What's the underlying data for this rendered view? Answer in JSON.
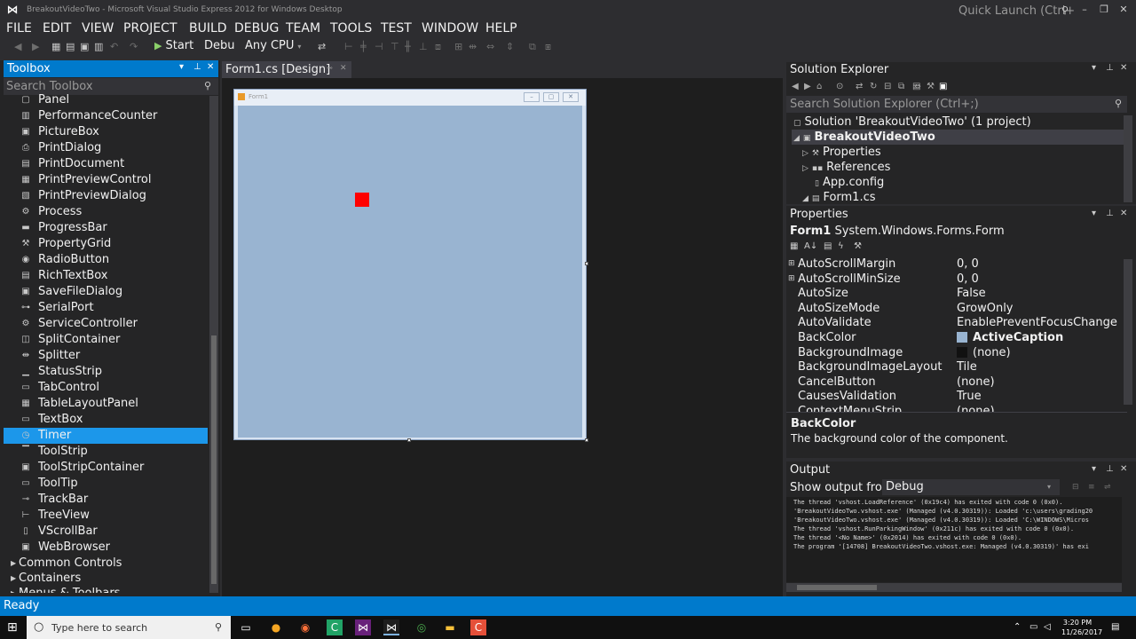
{
  "window": {
    "title": "BreakoutVideoTwo - Microsoft Visual Studio Express 2012 for Windows Desktop",
    "quick_launch_placeholder": "Quick Launch (Ctrl+Q)"
  },
  "menu": [
    "FILE",
    "EDIT",
    "VIEW",
    "PROJECT",
    "BUILD",
    "DEBUG",
    "TEAM",
    "TOOLS",
    "TEST",
    "WINDOW",
    "HELP"
  ],
  "toolbar": {
    "start_label": "Start",
    "config_value": "Debu",
    "platform_value": "Any CPU"
  },
  "toolbox": {
    "title": "Toolbox",
    "search_placeholder": "Search Toolbox",
    "items": [
      {
        "label": "Panel",
        "icon": "panel-icon"
      },
      {
        "label": "PerformanceCounter",
        "icon": "counter-icon"
      },
      {
        "label": "PictureBox",
        "icon": "picture-icon"
      },
      {
        "label": "PrintDialog",
        "icon": "print-icon"
      },
      {
        "label": "PrintDocument",
        "icon": "document-icon"
      },
      {
        "label": "PrintPreviewControl",
        "icon": "preview-icon"
      },
      {
        "label": "PrintPreviewDialog",
        "icon": "preview-dialog-icon"
      },
      {
        "label": "Process",
        "icon": "process-icon"
      },
      {
        "label": "ProgressBar",
        "icon": "progress-icon"
      },
      {
        "label": "PropertyGrid",
        "icon": "wrench-icon"
      },
      {
        "label": "RadioButton",
        "icon": "radio-icon"
      },
      {
        "label": "RichTextBox",
        "icon": "richtext-icon"
      },
      {
        "label": "SaveFileDialog",
        "icon": "save-icon"
      },
      {
        "label": "SerialPort",
        "icon": "port-icon"
      },
      {
        "label": "ServiceController",
        "icon": "service-icon"
      },
      {
        "label": "SplitContainer",
        "icon": "split-icon"
      },
      {
        "label": "Splitter",
        "icon": "splitter-icon"
      },
      {
        "label": "StatusStrip",
        "icon": "statusstrip-icon"
      },
      {
        "label": "TabControl",
        "icon": "tab-icon"
      },
      {
        "label": "TableLayoutPanel",
        "icon": "table-icon"
      },
      {
        "label": "TextBox",
        "icon": "textbox-icon"
      },
      {
        "label": "Timer",
        "icon": "timer-icon"
      },
      {
        "label": "ToolStrip",
        "icon": "toolstrip-icon"
      },
      {
        "label": "ToolStripContainer",
        "icon": "toolstrip-container-icon"
      },
      {
        "label": "ToolTip",
        "icon": "tooltip-icon"
      },
      {
        "label": "TrackBar",
        "icon": "trackbar-icon"
      },
      {
        "label": "TreeView",
        "icon": "treeview-icon"
      },
      {
        "label": "VScrollBar",
        "icon": "vscroll-icon"
      },
      {
        "label": "WebBrowser",
        "icon": "web-icon"
      }
    ],
    "selected_index": 21,
    "categories": [
      "Common Controls",
      "Containers",
      "Menus & Toolbars"
    ]
  },
  "document": {
    "tab_label": "Form1.cs [Design]",
    "form_title": "Form1"
  },
  "solution_explorer": {
    "title": "Solution Explorer",
    "search_placeholder": "Search Solution Explorer (Ctrl+;)",
    "tree": [
      {
        "label": "Solution 'BreakoutVideoTwo' (1 project)",
        "icon": "solution-icon"
      },
      {
        "label": "BreakoutVideoTwo",
        "icon": "csharp-project-icon"
      },
      {
        "label": "Properties",
        "icon": "wrench-icon"
      },
      {
        "label": "References",
        "icon": "references-icon"
      },
      {
        "label": "App.config",
        "icon": "config-icon"
      },
      {
        "label": "Form1.cs",
        "icon": "form-icon"
      }
    ]
  },
  "properties": {
    "title": "Properties",
    "object_name": "Form1",
    "object_type": "System.Windows.Forms.Form",
    "rows": [
      {
        "name": "AutoScrollMargin",
        "value": "0, 0",
        "expandable": true
      },
      {
        "name": "AutoScrollMinSize",
        "value": "0, 0",
        "expandable": true
      },
      {
        "name": "AutoSize",
        "value": "False"
      },
      {
        "name": "AutoSizeMode",
        "value": "GrowOnly"
      },
      {
        "name": "AutoValidate",
        "value": "EnablePreventFocusChange"
      },
      {
        "name": "BackColor",
        "value": "ActiveCaption",
        "swatch": "#99b4d1"
      },
      {
        "name": "BackgroundImage",
        "value": "(none)",
        "swatch": "#111111"
      },
      {
        "name": "BackgroundImageLayout",
        "value": "Tile"
      },
      {
        "name": "CancelButton",
        "value": "(none)"
      },
      {
        "name": "CausesValidation",
        "value": "True"
      },
      {
        "name": "ContextMenuStrip",
        "value": "(none)"
      }
    ],
    "description_title": "BackColor",
    "description_text": "The background color of the component."
  },
  "output": {
    "title": "Output",
    "show_from_label": "Show output from:",
    "source_value": "Debug",
    "lines": [
      "The thread 'vshost.LoadReference' (0x19c4) has exited with code 0 (0x0).",
      "'BreakoutVideoTwo.vshost.exe' (Managed (v4.0.30319)): Loaded 'c:\\users\\grading20",
      "'BreakoutVideoTwo.vshost.exe' (Managed (v4.0.30319)): Loaded 'C:\\WINDOWS\\Micros",
      "The thread 'vshost.RunParkingWindow' (0x211c) has exited with code 0 (0x0).",
      "The thread '<No Name>' (0x2014) has exited with code 0 (0x0).",
      "The program '[14708] BreakoutVideoTwo.vshost.exe: Managed (v4.0.30319)' has exi"
    ]
  },
  "status": {
    "text": "Ready"
  },
  "taskbar": {
    "search_placeholder": "Type here to search",
    "time": "3:20 PM",
    "date": "11/26/2017"
  },
  "colors": {
    "accent": "#007acc",
    "selection": "#1c97ea",
    "form_backcolor": "#99b4d1",
    "ball": "#ff0000"
  }
}
